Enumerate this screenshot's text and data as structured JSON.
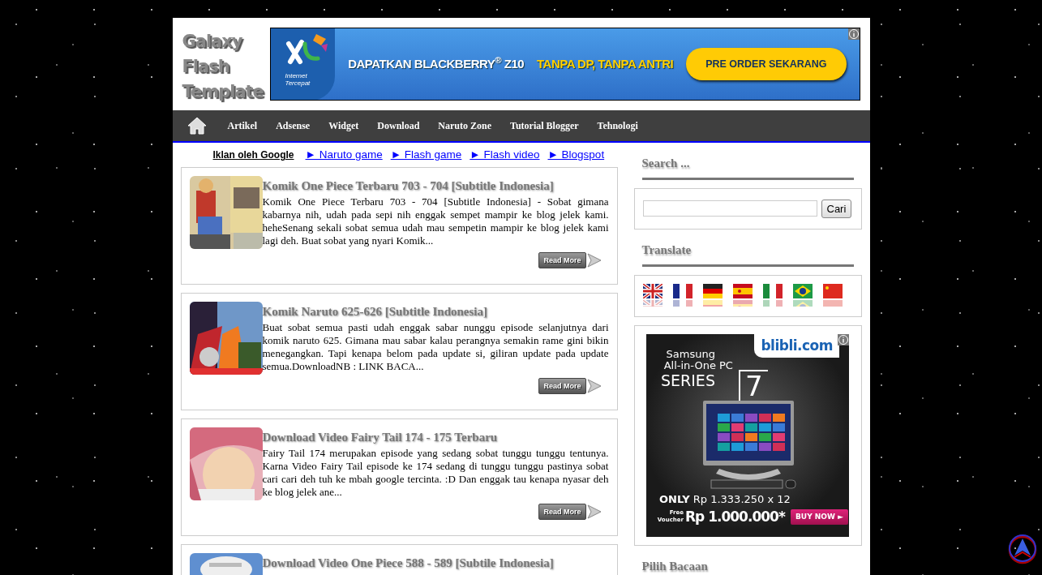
{
  "blog_title": "Galaxy Flash Template",
  "header_ad": {
    "logo_caption": "Internet Tercepat",
    "headline": "DAPATKAN BLACKBERRY$^{®}$ Z10",
    "tagline": "TANPA DP, TANPA ANTRI",
    "cta": "PRE ORDER SEKARANG"
  },
  "nav": {
    "items": [
      "Artikel",
      "Adsense",
      "Widget",
      "Download",
      "Naruto Zone",
      "Tutorial Blogger",
      "Tehnologi"
    ]
  },
  "ad_links": {
    "label": "Iklan oleh Google",
    "links": [
      "► Naruto game",
      "► Flash game",
      "► Flash video",
      "► Blogspot"
    ]
  },
  "posts": [
    {
      "title": "Komik One Piece Terbaru 703 - 704 [Subtitle Indonesia]",
      "excerpt": "Komik One Piece Terbaru 703 - 704 [Subtitle Indonesia] - Sobat gimana kabarnya nih, udah pada sepi nih enggak sempet mampir ke blog jelek kami. heheSenang sekali sobat semua udah mau sempetin mampir ke blog jelek kami lagi deh. Buat sobat yang nyari Komik...",
      "button": "Read More"
    },
    {
      "title": "Komik Naruto 625-626 [Subtitle Indonesia]",
      "excerpt": "Buat sobat semua pasti udah enggak sabar nunggu episode selanjutnya dari komik naruto 625. Gimana mau sabar kalau perangnya semakin rame gini bikin menegangkan. Tapi kenapa belom pada update si, giliran update pada update semua.DownloadNB : LINK BACA...",
      "button": "Read More"
    },
    {
      "title": "Download Video Fairy Tail 174 - 175 Terbaru",
      "excerpt": "Fairy Tail 174 merupakan episode yang sedang sobat tunggu tunggu tentunya. Karna Video Fairy Tail episode ke 174 sedang di tunggu tunggu pastinya sobat cari cari deh tuh ke mbah google tercinta. :D Dan enggak tau kenapa nyasar deh ke blog jelek ane...",
      "button": "Read More"
    },
    {
      "title": "Download Video One Piece 588 - 589 [Subtile Indonesia]"
    }
  ],
  "sidebar": {
    "search": {
      "heading": "Search ...",
      "button": "Cari"
    },
    "translate": {
      "heading": "Translate"
    },
    "ad": {
      "brand": "blibli.com",
      "line1": "Samsung",
      "line2": "All-in-One PC",
      "line3": "SERIES",
      "model": "7",
      "only": "ONLY",
      "price": "Rp 1.333.250 x 12",
      "voucher_label": "Free Voucher",
      "voucher": "Rp 1.000.000*",
      "cta": "BUY NOW ►"
    },
    "next_heading": "Pilih Bacaan"
  }
}
